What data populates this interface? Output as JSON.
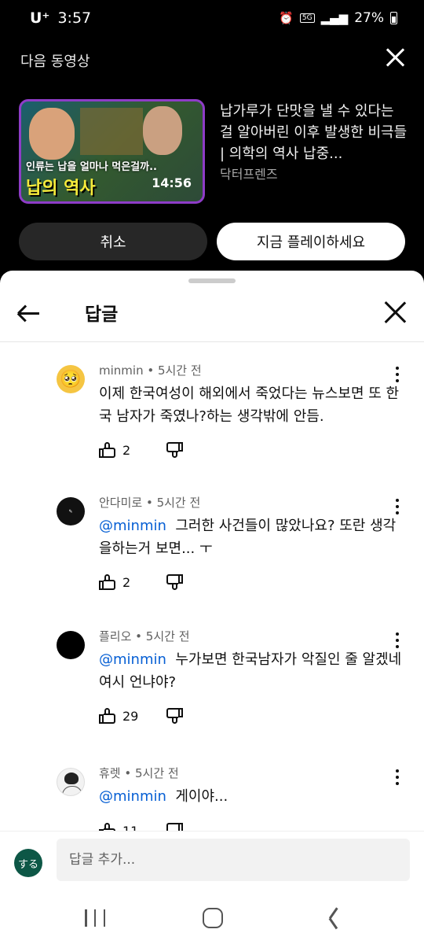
{
  "status_bar": {
    "carrier": "U⁺",
    "time": "3:57",
    "network": "5G",
    "battery": "27%"
  },
  "up_next": {
    "heading": "다음 동영상",
    "thumbnail": {
      "caption": "인류는 납을 얼마나 먹은걸까..",
      "big_text": "납의 역사",
      "duration": "14:56"
    },
    "video_title": "납가루가 단맛을 낼 수 있다는 걸 알아버린 이후 발생한 비극들 | 의학의 역사 납중...",
    "channel": "닥터프렌즈",
    "cancel_label": "취소",
    "play_label": "지금 플레이하세요",
    "accent_color": "#8e3cc7"
  },
  "replies_sheet": {
    "title": "답글",
    "comments": [
      {
        "author": "minmin",
        "time": "5시간 전",
        "mention": "",
        "text": "이제 한국여성이 해외에서 죽었다는 뉴스보면 또 한국 남자가 죽였나?하는 생각밖에 안듬.",
        "likes": "2",
        "avatar": "pleading-face-emoji"
      },
      {
        "author": "안다미로",
        "time": "5시간 전",
        "mention": "@minmin",
        "text": "그러한 사건들이 많았나요? 또란 생각을하는거 보면... ㅜ",
        "likes": "2",
        "avatar": "dark-text-avatar"
      },
      {
        "author": "플리오",
        "time": "5시간 전",
        "mention": "@minmin",
        "text": "누가보면 한국남자가 악질인 줄 알겠네 여시 언냐야?",
        "likes": "29",
        "avatar": "black-avatar"
      },
      {
        "author": "휴렛",
        "time": "5시간 전",
        "mention": "@minmin",
        "text": "게이야...",
        "likes": "11",
        "avatar": "sketch-avatar"
      }
    ],
    "reply_placeholder": "답글 추가...",
    "my_avatar_label": "する",
    "my_avatar_color": "#0d5746",
    "mention_color": "#065fd4"
  }
}
